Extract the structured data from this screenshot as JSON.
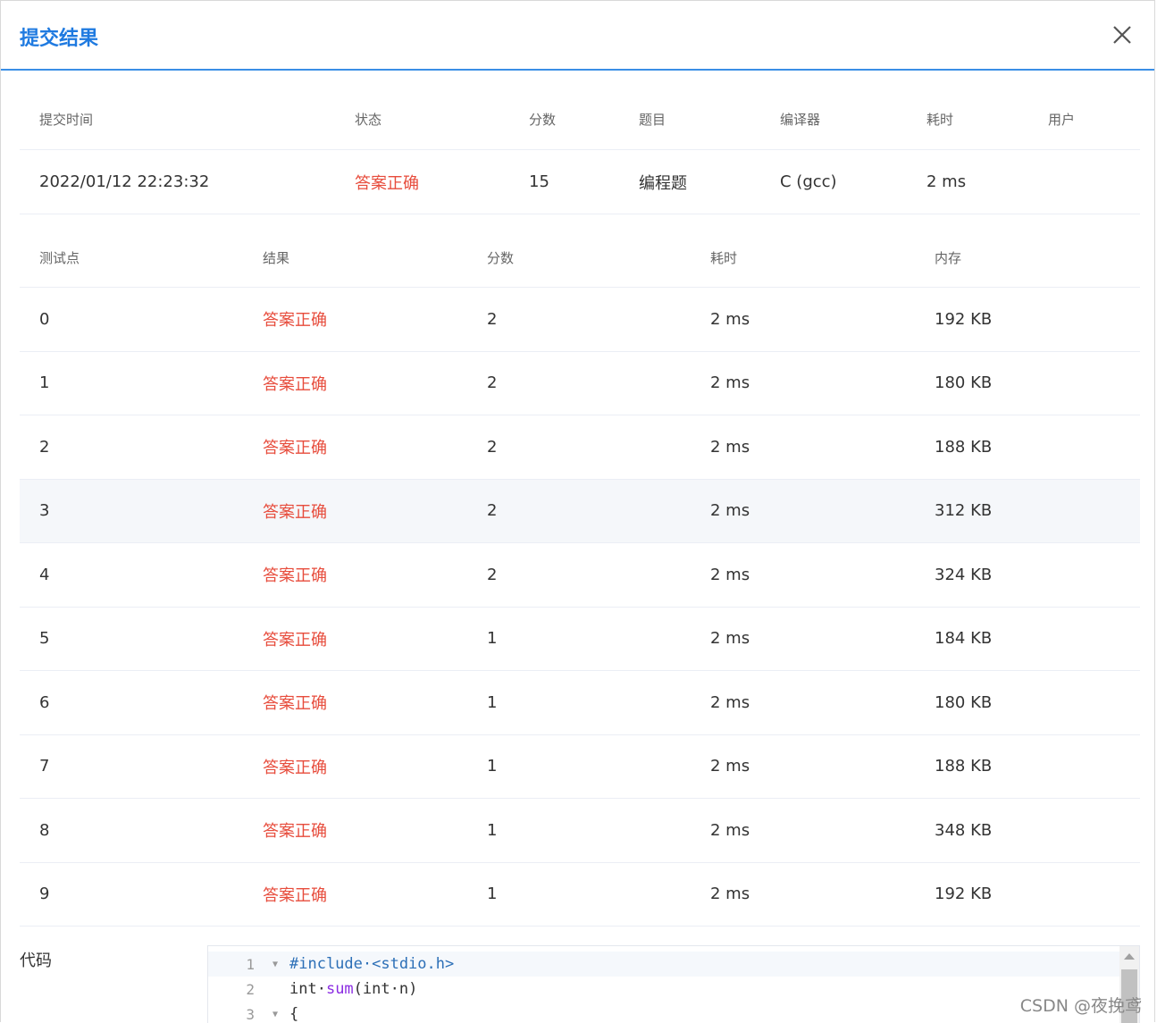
{
  "dialog": {
    "title": "提交结果"
  },
  "summary": {
    "headers": [
      "提交时间",
      "状态",
      "分数",
      "题目",
      "编译器",
      "耗时",
      "用户"
    ],
    "row": {
      "time": "2022/01/12 22:23:32",
      "status": "答案正确",
      "score": "15",
      "problem": "编程题",
      "compiler": "C (gcc)",
      "duration": "2 ms",
      "user": ""
    }
  },
  "cases": {
    "headers": [
      "测试点",
      "结果",
      "分数",
      "耗时",
      "内存"
    ],
    "rows": [
      {
        "id": "0",
        "result": "答案正确",
        "score": "2",
        "time": "2 ms",
        "memory": "192 KB"
      },
      {
        "id": "1",
        "result": "答案正确",
        "score": "2",
        "time": "2 ms",
        "memory": "180 KB"
      },
      {
        "id": "2",
        "result": "答案正确",
        "score": "2",
        "time": "2 ms",
        "memory": "188 KB"
      },
      {
        "id": "3",
        "result": "答案正确",
        "score": "2",
        "time": "2 ms",
        "memory": "312 KB"
      },
      {
        "id": "4",
        "result": "答案正确",
        "score": "2",
        "time": "2 ms",
        "memory": "324 KB"
      },
      {
        "id": "5",
        "result": "答案正确",
        "score": "1",
        "time": "2 ms",
        "memory": "184 KB"
      },
      {
        "id": "6",
        "result": "答案正确",
        "score": "1",
        "time": "2 ms",
        "memory": "180 KB"
      },
      {
        "id": "7",
        "result": "答案正确",
        "score": "1",
        "time": "2 ms",
        "memory": "188 KB"
      },
      {
        "id": "8",
        "result": "答案正确",
        "score": "1",
        "time": "2 ms",
        "memory": "348 KB"
      },
      {
        "id": "9",
        "result": "答案正确",
        "score": "1",
        "time": "2 ms",
        "memory": "192 KB"
      }
    ]
  },
  "code": {
    "label": "代码",
    "lines": [
      {
        "num": "1",
        "text": "#include·<stdio.h>"
      },
      {
        "num": "2",
        "text": "int·sum(int·n)"
      },
      {
        "num": "3",
        "text": "{"
      }
    ]
  },
  "watermark": "CSDN @夜挽鸢",
  "colors": {
    "accent": "#1f7ae0",
    "success_text": "#e74c3c",
    "row_highlight": "#f5f7fa"
  }
}
